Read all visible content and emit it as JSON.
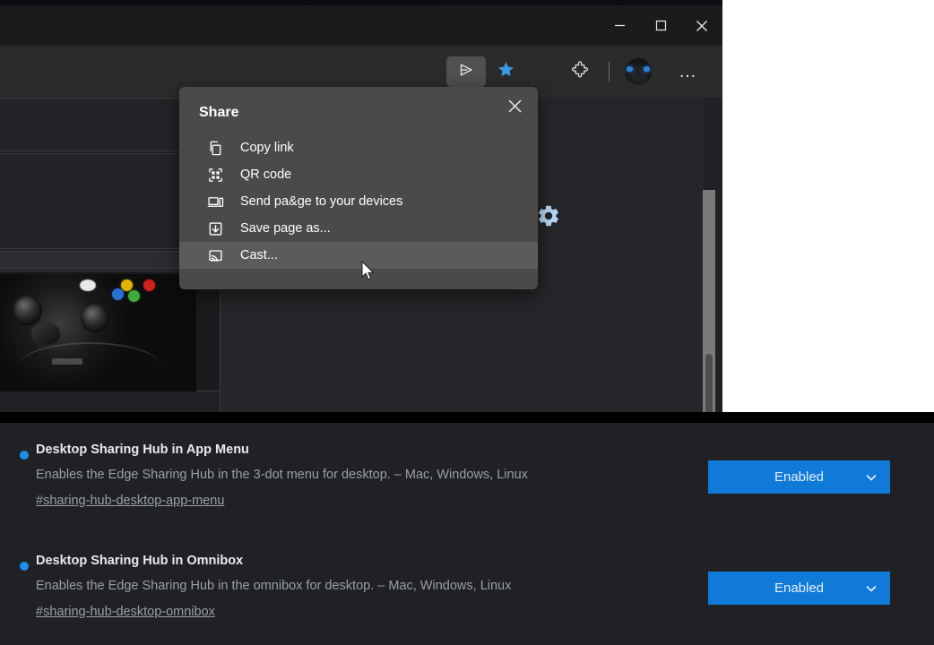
{
  "window": {
    "controls": [
      {
        "name": "minimize",
        "glyph": "minimize-icon"
      },
      {
        "name": "maximize",
        "glyph": "maximize-icon"
      },
      {
        "name": "close",
        "glyph": "close-icon"
      }
    ]
  },
  "toolbar": {
    "share_button": {
      "icon": "share-paper-plane-icon",
      "active": true
    },
    "favorite_button": {
      "icon": "star-filled-icon",
      "color": "#3a9ae0"
    },
    "extensions_button": {
      "icon": "puzzle-piece-icon"
    },
    "profile_avatar": {
      "icon": "avatar"
    },
    "settings_button": {
      "icon": "more-horizontal-icon",
      "label": "…"
    }
  },
  "share_popup": {
    "title": "Share",
    "close_label": "×",
    "items": [
      {
        "label": "Copy link",
        "icon": "copy-link-icon",
        "highlight": false
      },
      {
        "label": "QR code",
        "icon": "qr-code-icon",
        "highlight": false
      },
      {
        "label": "Send pa&ge to your devices",
        "icon": "send-device-icon",
        "highlight": false
      },
      {
        "label": "Save page as...",
        "icon": "save-page-icon",
        "highlight": false
      },
      {
        "label": "Cast...",
        "icon": "cast-icon",
        "highlight": true
      }
    ]
  },
  "page_behind": {
    "gear_icon": "gear-icon",
    "controller_image": "xbox-controller-image"
  },
  "flags": {
    "entries": [
      {
        "title": "Desktop Sharing Hub in App Menu",
        "description": "Enables the Edge Sharing Hub in the 3-dot menu for desktop. – Mac, Windows, Linux",
        "link": "#sharing-hub-desktop-app-menu",
        "state": "Enabled"
      },
      {
        "title": "Desktop Sharing Hub in Omnibox",
        "description": "Enables the Edge Sharing Hub in the omnibox for desktop. – Mac, Windows, Linux",
        "link": "#sharing-hub-desktop-omnibox",
        "state": "Enabled"
      }
    ]
  },
  "colors": {
    "accent_blue": "#1b8ee8",
    "select_blue": "#0f7ad8",
    "star_blue": "#3a9ae0",
    "popup_bg": "#4a4a4a",
    "popup_highlight": "#5b5b5b",
    "page_bg": "#202124",
    "toolbar_bg": "#2b2b2b"
  }
}
